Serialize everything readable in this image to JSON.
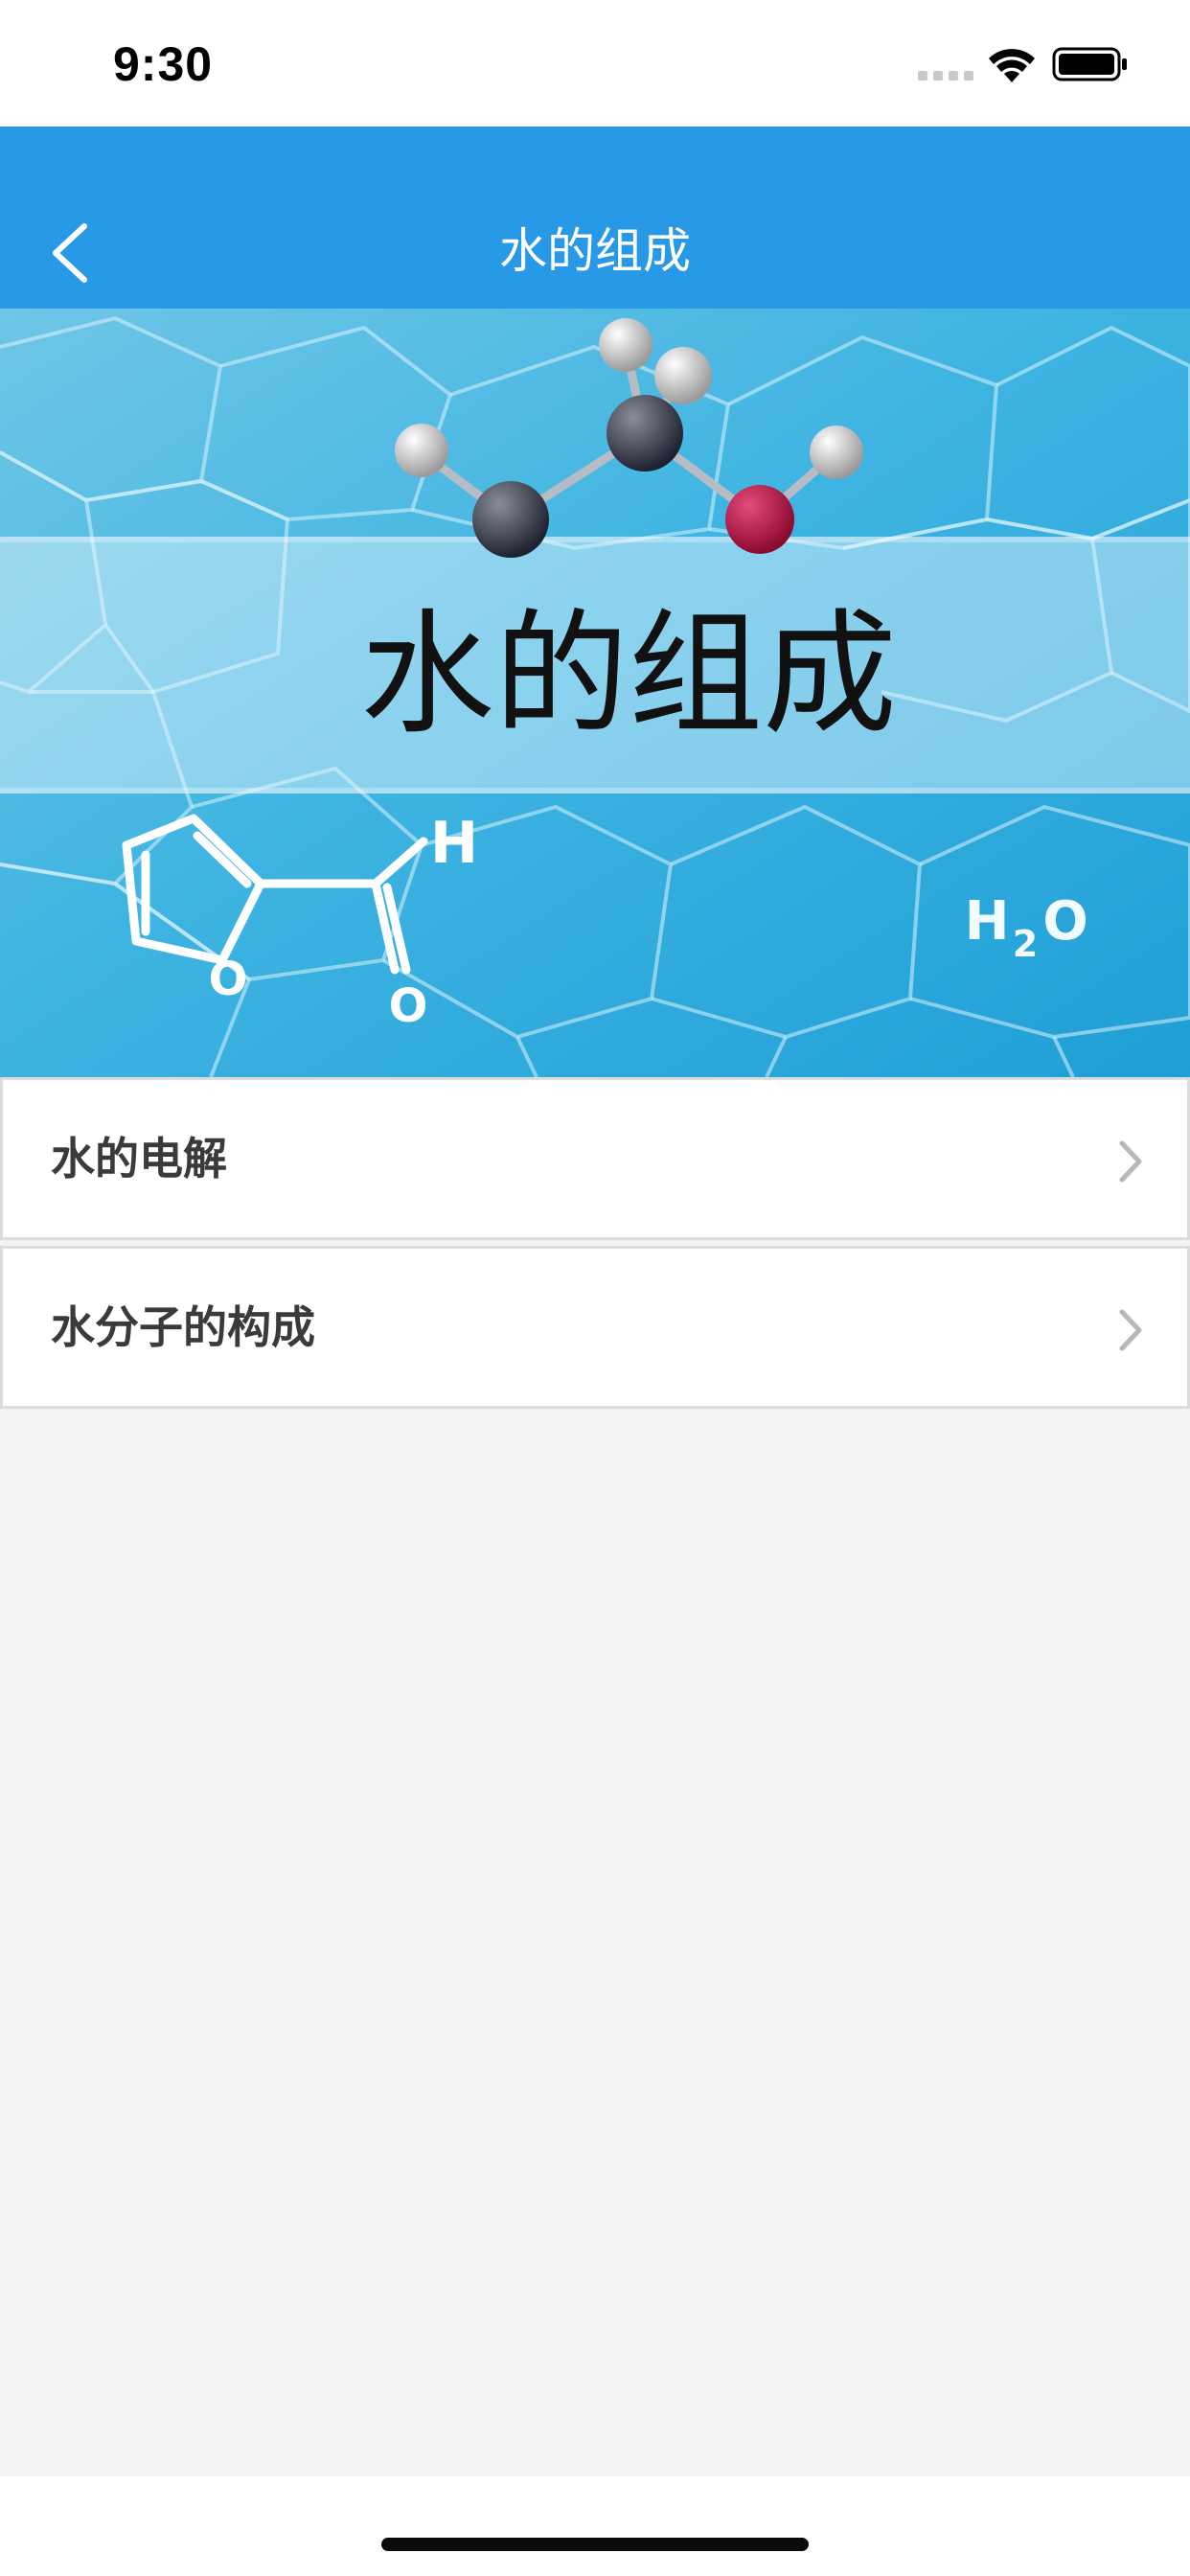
{
  "status_bar": {
    "time": "9:30"
  },
  "nav": {
    "title": "水的组成",
    "back_icon": "chevron-left-icon"
  },
  "banner": {
    "title": "水的组成",
    "formula_h": "H",
    "formula_sub": "2",
    "formula_o": "O",
    "atom_label_o": "O",
    "atom_label_h": "H"
  },
  "list": {
    "items": [
      {
        "label": "水的电解",
        "icon": "chevron-right-icon"
      },
      {
        "label": "水分子的构成",
        "icon": "chevron-right-icon"
      }
    ]
  },
  "colors": {
    "nav_bar": "#2899e6",
    "background": "#f3f3f3",
    "list_text": "#3a3a3a"
  }
}
